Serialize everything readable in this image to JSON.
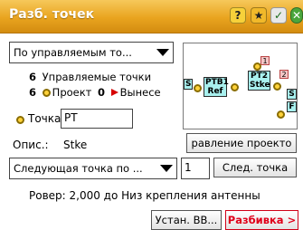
{
  "window": {
    "title": "Разб. точек"
  },
  "titlebar_icons": {
    "help": "?",
    "star": "★",
    "check": "✓",
    "close": "✕"
  },
  "view_dropdown": {
    "value": "По управляемым то..."
  },
  "counts": {
    "controlled_count": "6",
    "controlled_label": "Управляемые точки",
    "design_count": "6",
    "design_label": "Проект",
    "staked_count": "0",
    "staked_label": "Вынесе"
  },
  "map": {
    "labels": {
      "ptb1": "PTB1",
      "ref": "Ref",
      "pt2": "PT2",
      "stke": "Stke",
      "s_left": "S",
      "s_right": "S",
      "n1": "1",
      "n2": "2",
      "f": "F"
    }
  },
  "point": {
    "label": "Точка:",
    "value": "PT"
  },
  "description": {
    "label": "Опис.:",
    "value": "Stke"
  },
  "buttons": {
    "manage_design": "равление проекто",
    "next_point": "След. точка",
    "setup": "Устан. ВВ...",
    "stakeout": "Разбивка >"
  },
  "next_dropdown": {
    "value": "Следующая точка по ..."
  },
  "next_step": {
    "value": "1"
  },
  "rover": {
    "text": "Ровер: 2,000 до Низ крепления антенны"
  },
  "colors": {
    "titlebar": "#e9a41f",
    "stakeout_text": "#e0001a",
    "map_node": "#a8f0ee"
  }
}
